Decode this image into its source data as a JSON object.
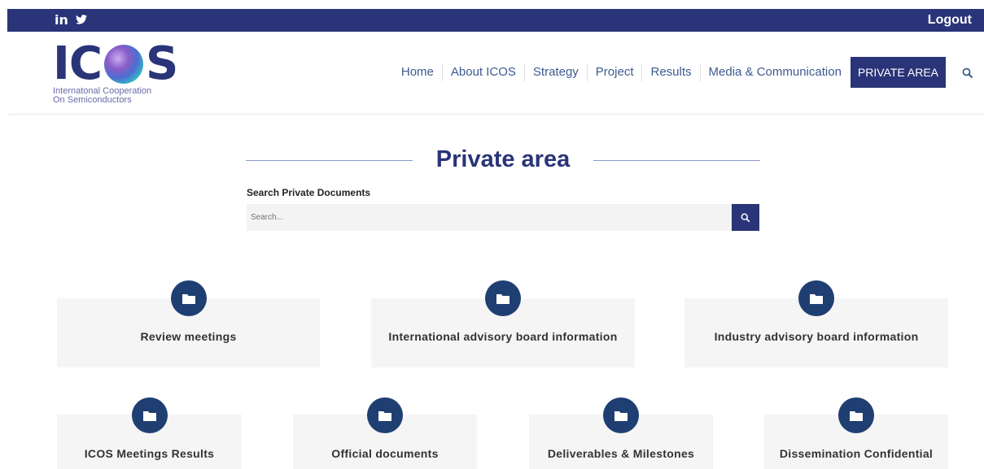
{
  "topbar": {
    "social": [
      "in",
      "🐦"
    ],
    "logout_label": "Logout"
  },
  "logo": {
    "letters_left": "IC",
    "letters_right": "S",
    "subtitle_line1": "Internatonal Cooperation",
    "subtitle_line2": "On Semiconductors"
  },
  "nav": {
    "items": [
      "Home",
      "About ICOS",
      "Strategy",
      "Project",
      "Results",
      "Media & Communication"
    ],
    "private_label": "PRIVATE AREA"
  },
  "page": {
    "title": "Private area",
    "search_label": "Search Private Documents",
    "search_placeholder": "Search..."
  },
  "cards_row1": [
    {
      "label": "Review meetings"
    },
    {
      "label": "International advisory board information"
    },
    {
      "label": "Industry advisory board information"
    }
  ],
  "cards_row2": [
    {
      "label": "ICOS Meetings Results"
    },
    {
      "label": "Official documents"
    },
    {
      "label": "Deliverables & Milestones"
    },
    {
      "label": "Dissemination Confidential"
    }
  ],
  "colors": {
    "brand": "#2a3478",
    "icon_circle": "#1f3f73",
    "card_bg": "#f5f5f5"
  }
}
